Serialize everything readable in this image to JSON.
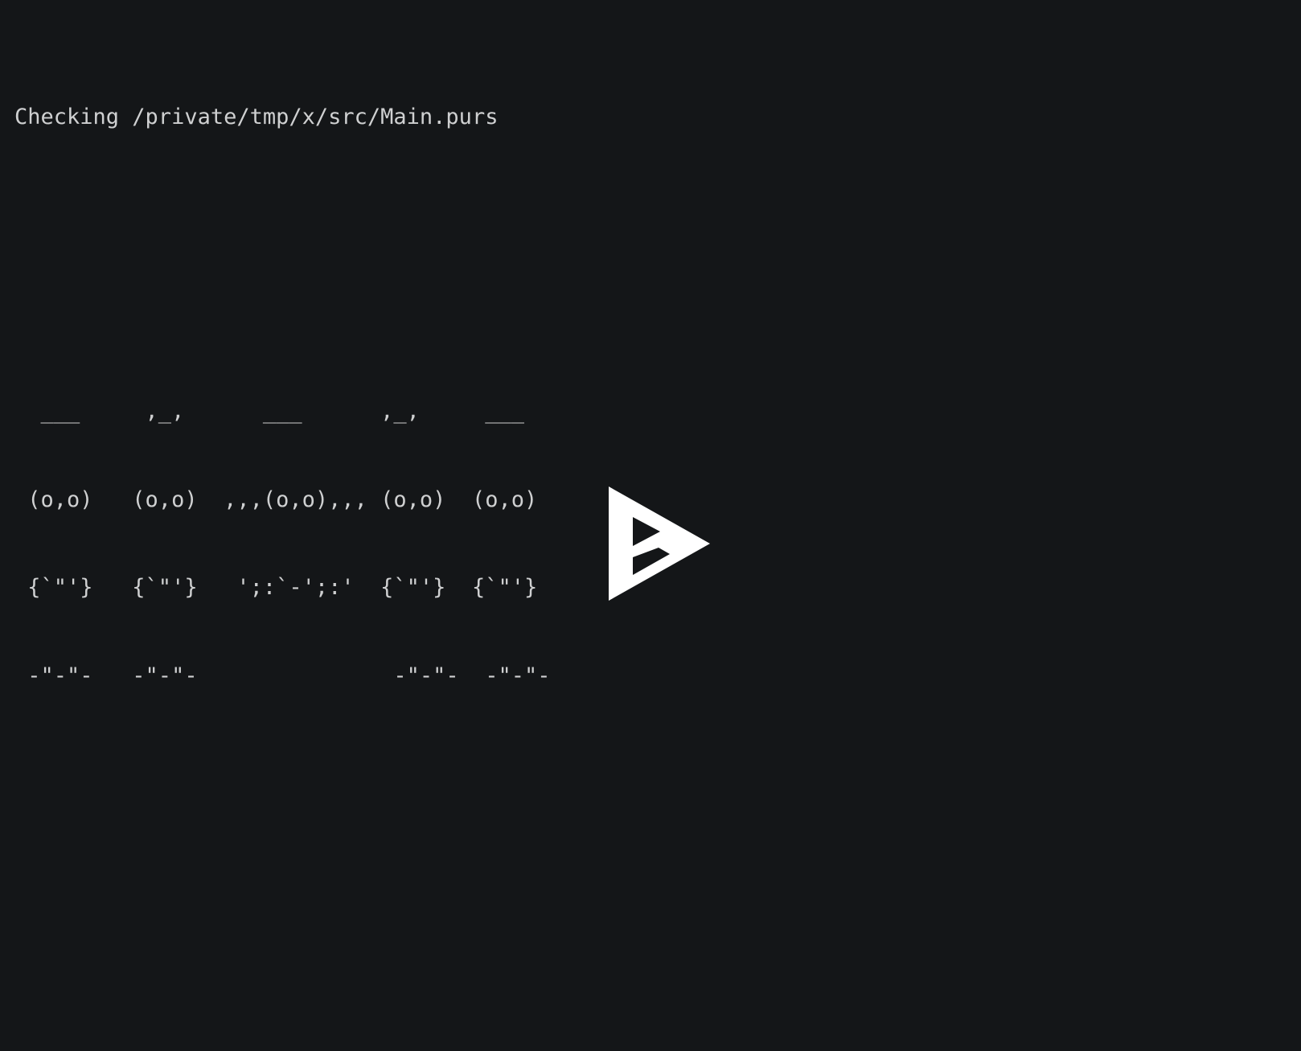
{
  "player": {
    "name": "asciinema-player",
    "state": "paused",
    "background_color": "#141618",
    "foreground_color": "#cfd0d1",
    "play_icon": "play-triangle-icon"
  },
  "terminal": {
    "lines": [
      "Checking /private/tmp/x/src/Main.purs",
      "",
      "  ___     ,_,      ___      ,_,     ___",
      " (o,o)   (o,o)  ,,,(o,o),,, (o,o)  (o,o)",
      " {`\"'}   {`\"'}   ';:`-';:'  {`\"'}  {`\"'}",
      " -\"-\"-   -\"-\"-               -\"-\"-  -\"-\"-"
    ],
    "status_line": "Checking /private/tmp/x/src/Main.purs",
    "ascii_art": {
      "name": "purescript-owls-ascii-art",
      "row_1": "  ___     ,_,      ___      ,_,     ___",
      "row_2": " (o,o)   (o,o)  ,,,(o,o),,, (o,o)  (o,o)",
      "row_3": " {`\"'}   {`\"'}   ';:`-';:'  {`\"'}  {`\"'}",
      "row_4": " -\"-\"-   -\"-\"-               -\"-\"-  -\"-\"-"
    }
  }
}
